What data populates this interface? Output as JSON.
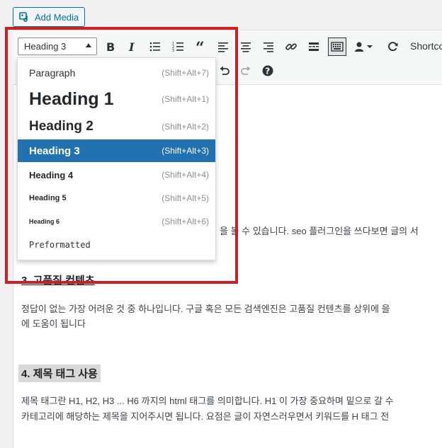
{
  "add_media": {
    "label": "Add Media",
    "icon": "media-icon"
  },
  "toolbar": {
    "format_select": "Heading 3",
    "shortcode_label": "Shortco",
    "buttons": [
      "bold",
      "italic",
      "bulleted-list",
      "numbered-list",
      "blockquote",
      "align-left",
      "align-center",
      "align-right",
      "insert-link",
      "read-more",
      "toolbar-toggle",
      "user",
      "refresh",
      "undo",
      "redo",
      "help"
    ]
  },
  "dropdown": {
    "items": [
      {
        "label": "Paragraph",
        "shortcut": "(Shift+Alt+7)"
      },
      {
        "label": "Heading 1",
        "shortcut": "(Shift+Alt+1)"
      },
      {
        "label": "Heading 2",
        "shortcut": "(Shift+Alt+2)"
      },
      {
        "label": "Heading 3",
        "shortcut": "(Shift+Alt+3)",
        "selected": true
      },
      {
        "label": "Heading 4",
        "shortcut": "(Shift+Alt+4)"
      },
      {
        "label": "Heading 5",
        "shortcut": "(Shift+Alt+5)"
      },
      {
        "label": "Heading 6",
        "shortcut": "(Shift+Alt+6)"
      },
      {
        "label": "Preformatted",
        "shortcut": ""
      }
    ]
  },
  "content": {
    "line1_tail": "을 볼 수 있습니다. seo 플러그인을 쓰다보면 글의 서",
    "heading3": "3. 고품질 컨텐츠",
    "para2_line1": "정답이 없는 가장 어려운 것 중 하나입니다. 구글 혹은 모든 검색엔진은 고품질 컨텐츠를 상위에 을",
    "para2_line2": "에 도움이 됩니다",
    "heading4": "4. 제목 태그 사용",
    "para3_line1": "제목 태그란 H1, H2, H3 ... H6 까지의 html 태그를 의미합니다. H1 이 가장 중요하며 밑으로 갈 수",
    "para3_line2": "카테고리에 해당하는 제목을 지어주시면 됩니다. 요점은 글이 자연스러우면서 키워드를 H 태그 전"
  },
  "colors": {
    "selected": "#2271b1",
    "highlight_box": "#cc1e23",
    "accent": "#0071a1"
  }
}
